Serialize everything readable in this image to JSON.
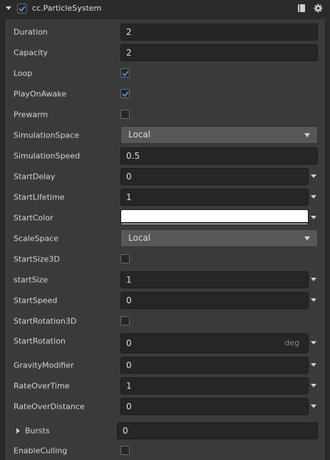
{
  "component": {
    "title": "cc.ParticleSystem",
    "enabled": true,
    "icons": [
      "chevron-down-icon",
      "book-icon",
      "gear-icon"
    ]
  },
  "properties": {
    "duration": {
      "label": "Duration",
      "value": "2"
    },
    "capacity": {
      "label": "Capacity",
      "value": "2"
    },
    "loop": {
      "label": "Loop",
      "checked": true
    },
    "playOnAwake": {
      "label": "PlayOnAwake",
      "checked": true
    },
    "prewarm": {
      "label": "Prewarm",
      "checked": false
    },
    "simulationSpace": {
      "label": "SimulationSpace",
      "value": "Local"
    },
    "simulationSpeed": {
      "label": "SimulationSpeed",
      "value": "0.5"
    },
    "startDelay": {
      "label": "StartDelay",
      "value": "0"
    },
    "startLifetime": {
      "label": "StartLifetime",
      "value": "1"
    },
    "startColor": {
      "label": "StartColor",
      "color": "#ffffff"
    },
    "scaleSpace": {
      "label": "ScaleSpace",
      "value": "Local"
    },
    "startSize3D": {
      "label": "StartSize3D",
      "checked": false
    },
    "startSize": {
      "label": "startSize",
      "value": "1"
    },
    "startSpeed": {
      "label": "StartSpeed",
      "value": "0"
    },
    "startRotation3D": {
      "label": "StartRotation3D",
      "checked": false
    },
    "startRotation": {
      "label": "StartRotation",
      "value": "0",
      "unit": "deg"
    },
    "gravityModifier": {
      "label": "GravityModifier",
      "value": "0"
    },
    "rateOverTime": {
      "label": "RateOverTime",
      "value": "1"
    },
    "rateOverDistance": {
      "label": "RateOverDistance",
      "value": "0"
    },
    "bursts": {
      "label": "Bursts",
      "value": "0"
    },
    "enableCulling": {
      "label": "EnableCulling",
      "checked": false
    }
  },
  "colors": {
    "accent": "#4a8bd6",
    "panel": "#3a3a3a",
    "field": "#262626"
  }
}
